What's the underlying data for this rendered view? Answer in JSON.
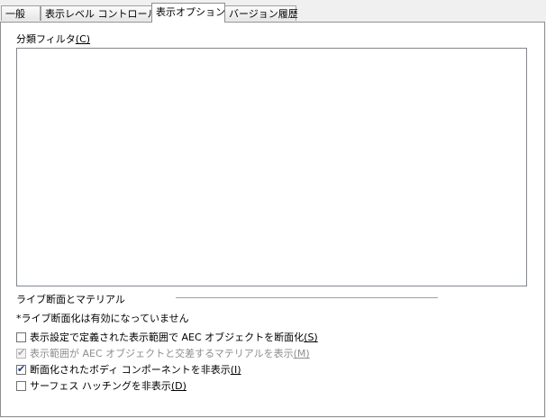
{
  "tabs": [
    {
      "label": "一般"
    },
    {
      "label": "表示レベル コントロール"
    },
    {
      "label": "表示オプション"
    },
    {
      "label": "バージョン履歴"
    }
  ],
  "filter": {
    "label_main": "分類フィルタ",
    "label_key": "(C)"
  },
  "live_section": {
    "title": "ライブ断面とマテリアル",
    "note": "*ライブ断面化は有効になっていません"
  },
  "options": [
    {
      "text": "表示設定で定義された表示範囲で AEC オブジェクトを断面化",
      "key": "(S)",
      "checked": false,
      "disabled": false
    },
    {
      "text": "表示範囲が AEC オブジェクトと交差するマテリアルを表示",
      "key": "(M)",
      "checked": true,
      "disabled": true
    },
    {
      "text": "断面化されたボディ コンポーネントを非表示",
      "key": "(I)",
      "checked": true,
      "disabled": false
    },
    {
      "text": "サーフェス ハッチングを非表示",
      "key": "(D)",
      "checked": false,
      "disabled": false
    }
  ],
  "icons": {
    "check": "checkmark-icon"
  }
}
